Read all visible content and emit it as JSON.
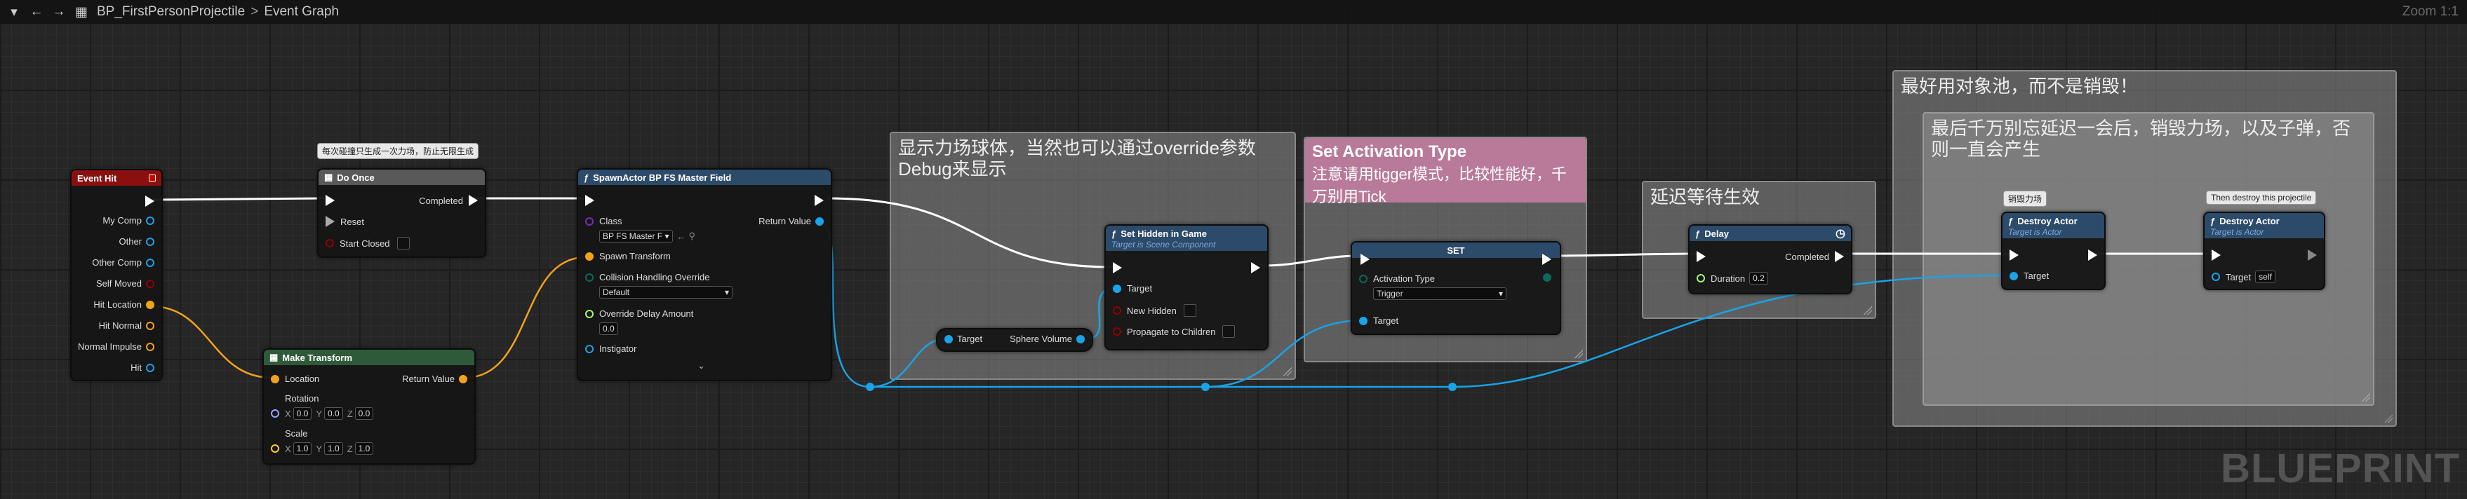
{
  "toolbar": {
    "title": "BP_FirstPersonProjectile",
    "crumb_sep": ">",
    "graph": "Event Graph",
    "zoom": "Zoom 1:1"
  },
  "watermark": "BLUEPRINT",
  "comments": {
    "show_sphere": "显示力场球体，当然也可以通过override参数Debug来显示",
    "set_activation_title": "Set Activation Type",
    "set_activation_body": "注意请用tigger模式，比较性能好，千万别用Tick",
    "delay_note": "延迟等待生效",
    "pool_outer": "最好用对象池，而不是销毁！",
    "pool_inner": "最后千万别忘延迟一会后，销毁力场，以及子弹，否则一直会产生"
  },
  "event_hit": {
    "title": "Event Hit",
    "pins": [
      "My Comp",
      "Other",
      "Other Comp",
      "Self Moved",
      "Hit Location",
      "Hit Normal",
      "Normal Impulse",
      "Hit"
    ]
  },
  "do_once": {
    "bubble": "每次碰撞只生成一次力场，防止无限生成",
    "title": "Do Once",
    "completed": "Completed",
    "reset": "Reset",
    "start_closed": "Start Closed"
  },
  "make_transform": {
    "title": "Make Transform",
    "location": "Location",
    "return_value": "Return Value",
    "rotation": "Rotation",
    "scale": "Scale",
    "x": "X",
    "y": "Y",
    "z": "Z",
    "rot_x": "0.0",
    "rot_y": "0.0",
    "rot_z": "0.0",
    "scale_x": "1.0",
    "scale_y": "1.0",
    "scale_z": "1.0"
  },
  "spawn": {
    "title": "SpawnActor BP FS Master Field",
    "class_label": "Class",
    "class_value": "BP FS Master F",
    "return_value": "Return Value",
    "spawn_transform": "Spawn Transform",
    "collision_label": "Collision Handling Override",
    "collision_value": "Default",
    "override_delay": "Override Delay Amount",
    "override_delay_value": "0.0",
    "instigator": "Instigator"
  },
  "sphere_getter": {
    "target": "Target",
    "output": "Sphere Volume"
  },
  "set_hidden": {
    "title": "Set Hidden in Game",
    "subtitle": "Target is Scene Component",
    "target": "Target",
    "new_hidden": "New Hidden",
    "propagate": "Propagate to Children"
  },
  "set_node": {
    "title": "SET",
    "activation_label": "Activation Type",
    "activation_value": "Trigger",
    "target": "Target"
  },
  "delay": {
    "title": "Delay",
    "completed": "Completed",
    "duration": "Duration",
    "duration_value": "0.2"
  },
  "destroy1": {
    "bubble": "销毁力场",
    "title": "Destroy Actor",
    "subtitle": "Target is Actor",
    "target": "Target"
  },
  "destroy2": {
    "bubble": "Then destroy this projectile",
    "title": "Destroy Actor",
    "subtitle": "Target is Actor",
    "target": "Target",
    "self": "self"
  },
  "colors": {
    "event_header": "#8a1010",
    "function_header": "#2c4a6a",
    "macro_header": "#595959",
    "make_header": "#2f5a3a",
    "comment_gray": "#6e6e6e",
    "comment_pink": "#b87a98",
    "object_pin": "#1aa3e8",
    "struct_pin": "#f2a21a",
    "bool_pin": "#930000",
    "float_pin": "#a6f57b",
    "enum_pin": "#0a6b5a"
  }
}
